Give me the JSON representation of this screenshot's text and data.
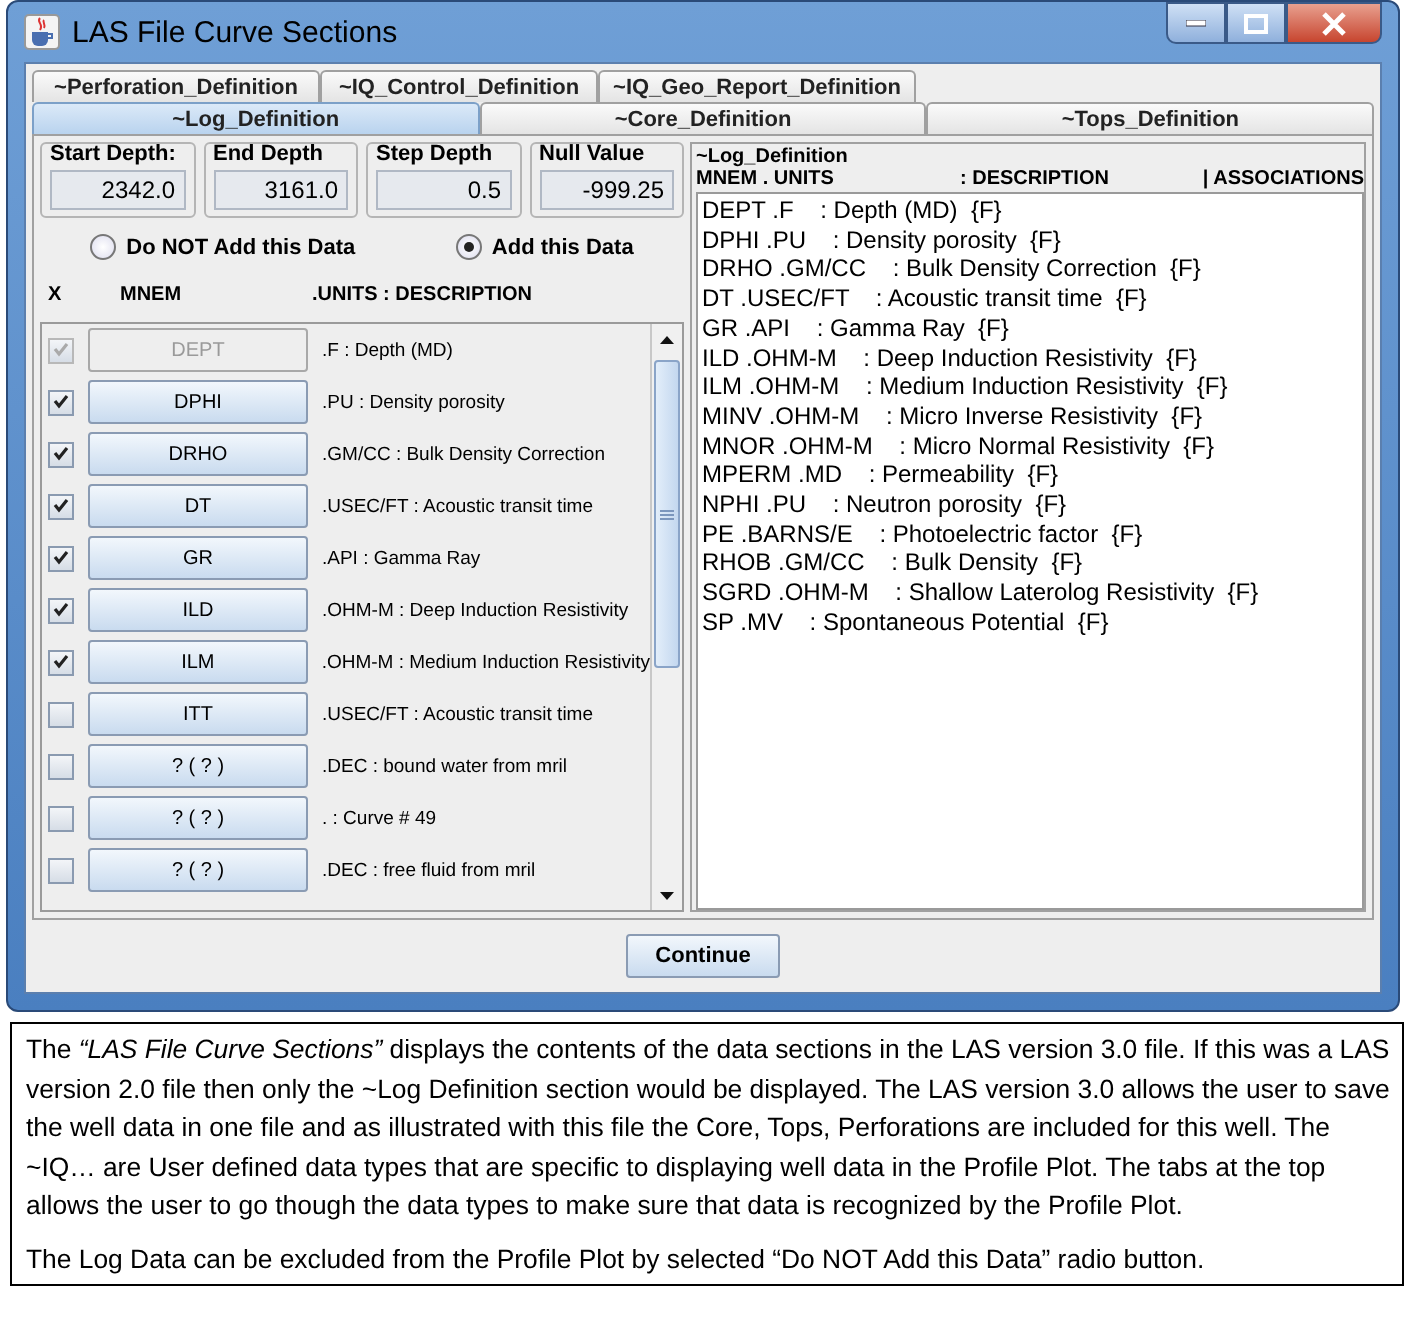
{
  "window": {
    "title": "LAS File Curve Sections"
  },
  "tabs_back": [
    {
      "label": "~Perforation_Definition",
      "selected": false
    },
    {
      "label": "~IQ_Control_Definition",
      "selected": false
    },
    {
      "label": "~IQ_Geo_Report_Definition",
      "selected": false
    }
  ],
  "tabs_front": [
    {
      "label": "~Log_Definition",
      "selected": true
    },
    {
      "label": "~Core_Definition",
      "selected": false
    },
    {
      "label": "~Tops_Definition",
      "selected": false
    }
  ],
  "depth_fields": [
    {
      "label": "Start Depth:",
      "value": "2342.0"
    },
    {
      "label": "End Depth",
      "value": "3161.0"
    },
    {
      "label": "Step Depth",
      "value": "0.5"
    },
    {
      "label": "Null Value",
      "value": "-999.25"
    }
  ],
  "radios": [
    {
      "label": "Do NOT Add this Data",
      "selected": false
    },
    {
      "label": "Add this Data",
      "selected": true
    }
  ],
  "curve_headers": [
    "X",
    "MNEM",
    ".UNITS  : DESCRIPTION"
  ],
  "curves": [
    {
      "checked": true,
      "disabled": true,
      "mnem": "DEPT",
      "description": ".F : Depth (MD)"
    },
    {
      "checked": true,
      "disabled": false,
      "mnem": "DPHI",
      "description": ".PU : Density porosity"
    },
    {
      "checked": true,
      "disabled": false,
      "mnem": "DRHO",
      "description": ".GM/CC : Bulk Density Correction"
    },
    {
      "checked": true,
      "disabled": false,
      "mnem": "DT",
      "description": ".USEC/FT : Acoustic transit time"
    },
    {
      "checked": true,
      "disabled": false,
      "mnem": "GR",
      "description": ".API : Gamma Ray"
    },
    {
      "checked": true,
      "disabled": false,
      "mnem": "ILD",
      "description": ".OHM-M : Deep Induction Resistivity"
    },
    {
      "checked": true,
      "disabled": false,
      "mnem": "ILM",
      "description": ".OHM-M : Medium Induction Resistivity"
    },
    {
      "checked": false,
      "disabled": false,
      "mnem": "ITT",
      "description": ".USEC/FT : Acoustic transit time"
    },
    {
      "checked": false,
      "disabled": false,
      "mnem": "? ( ? )",
      "description": ".DEC : bound water from mril"
    },
    {
      "checked": false,
      "disabled": false,
      "mnem": "? ( ? )",
      "description": ". : Curve #  49"
    },
    {
      "checked": false,
      "disabled": false,
      "mnem": "? ( ? )",
      "description": ".DEC : free fluid from mril"
    }
  ],
  "section": {
    "title": "~Log_Definition",
    "columns": [
      "MNEM . UNITS",
      ": DESCRIPTION",
      "| ASSOCIATIONS"
    ],
    "lines": [
      "DEPT .F    : Depth (MD)  {F}",
      "DPHI .PU    : Density porosity  {F}",
      "DRHO .GM/CC    : Bulk Density Correction  {F}",
      "DT .USEC/FT    : Acoustic transit time  {F}",
      "GR .API    : Gamma Ray  {F}",
      "ILD .OHM-M    : Deep Induction Resistivity  {F}",
      "ILM .OHM-M    : Medium Induction Resistivity  {F}",
      "MINV .OHM-M    : Micro Inverse Resistivity  {F}",
      "MNOR .OHM-M    : Micro Normal Resistivity  {F}",
      "MPERM .MD    : Permeability  {F}",
      "NPHI .PU    : Neutron porosity  {F}",
      "PE .BARNS/E    : Photoelectric factor  {F}",
      "RHOB .GM/CC    : Bulk Density  {F}",
      "SGRD .OHM-M    : Shallow Laterolog Resistivity  {F}",
      "SP .MV    : Spontaneous Potential  {F}"
    ]
  },
  "continue_button": "Continue",
  "caption": [
    "The *“LAS File Curve Sections”* displays the contents of the data sections in the LAS version 3.0 file.  If this was a LAS version 2.0 file then only the ~Log Definition section would be displayed.  The LAS version 3.0 allows the user to save the well data in one file and as illustrated with this file the Core, Tops, Perforations are included for this well.  The ~IQ… are User defined data types that are specific to displaying well data in the Profile Plot.  The tabs at the top allows the user to go though the data types to make sure that data is recognized by the Profile Plot.",
    "The Log Data can be excluded from the Profile Plot by selected “Do NOT Add this Data” radio button."
  ]
}
